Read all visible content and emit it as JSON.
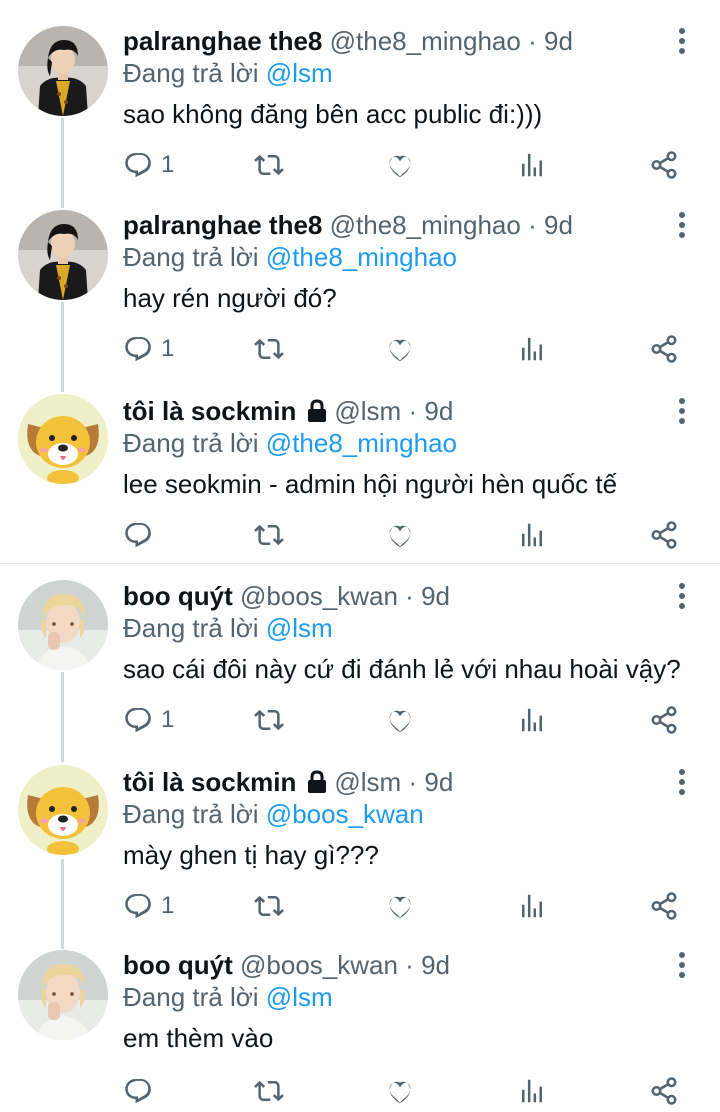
{
  "reply_prefix": "Đang trả lời",
  "colors": {
    "mention": "#1d9bf0",
    "secondary": "#536471",
    "thread_line": "#cfd9de"
  },
  "tweets": [
    {
      "name": "palranghae the8",
      "handle": "@the8_minghao",
      "time": "9d",
      "protected": false,
      "reply_to": "@lsm",
      "text": "sao không đăng bên acc public đi:)))",
      "reply_count": "1",
      "avatar": "dark-hair-person-avatar"
    },
    {
      "name": "palranghae the8",
      "handle": "@the8_minghao",
      "time": "9d",
      "protected": false,
      "reply_to": "@the8_minghao",
      "text": "hay rén người đó?",
      "reply_count": "1",
      "avatar": "dark-hair-person-avatar"
    },
    {
      "name": "tôi là sockmin",
      "handle": "@lsm",
      "time": "9d",
      "protected": true,
      "reply_to": "@the8_minghao",
      "text": "lee seokmin - admin hội người hèn quốc tế",
      "reply_count": "",
      "avatar": "dog-cartoon-avatar"
    },
    {
      "name": "boo quýt",
      "handle": "@boos_kwan",
      "time": "9d",
      "protected": false,
      "reply_to": "@lsm",
      "text": "sao cái đôi này cứ đi đánh lẻ với nhau hoài vậy?",
      "reply_count": "1",
      "avatar": "blonde-person-avatar"
    },
    {
      "name": "tôi là sockmin",
      "handle": "@lsm",
      "time": "9d",
      "protected": true,
      "reply_to": "@boos_kwan",
      "text": "mày ghen tị hay gì???",
      "reply_count": "1",
      "avatar": "dog-cartoon-avatar"
    },
    {
      "name": "boo quýt",
      "handle": "@boos_kwan",
      "time": "9d",
      "protected": false,
      "reply_to": "@lsm",
      "text": "em thèm vào",
      "reply_count": "",
      "avatar": "blonde-person-avatar"
    }
  ]
}
